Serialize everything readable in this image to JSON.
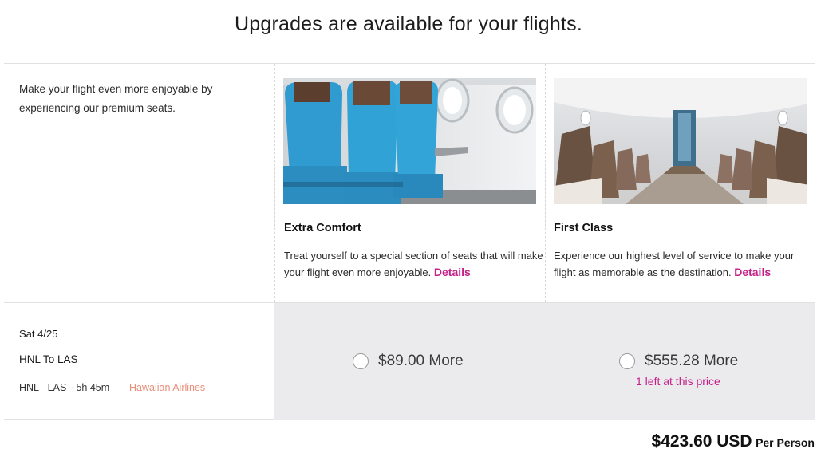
{
  "header": {
    "title": "Upgrades are available for your flights."
  },
  "intro": {
    "text": "Make your flight even more enjoyable by experiencing our premium seats."
  },
  "cabins": [
    {
      "name": "Extra Comfort",
      "description": "Treat yourself to a special section of seats that will make your flight even more enjoyable.",
      "details_label": "Details",
      "price_label": "$89.00 More",
      "scarcity": ""
    },
    {
      "name": "First Class",
      "description": "Experience our highest level of service to make your flight as memorable as the destination.",
      "details_label": "Details",
      "price_label": "$555.28 More",
      "scarcity": "1 left at this price"
    }
  ],
  "flight": {
    "date": "Sat 4/25",
    "route": "HNL To LAS",
    "segment": "HNL - LAS",
    "duration": "5h 45m",
    "airline": "Hawaiian Airlines"
  },
  "total": {
    "amount": "$423.60 USD",
    "label": "Per Person"
  },
  "colors": {
    "accent": "#c4208a",
    "airline": "#e8907a",
    "price_bg": "#ebebed"
  }
}
